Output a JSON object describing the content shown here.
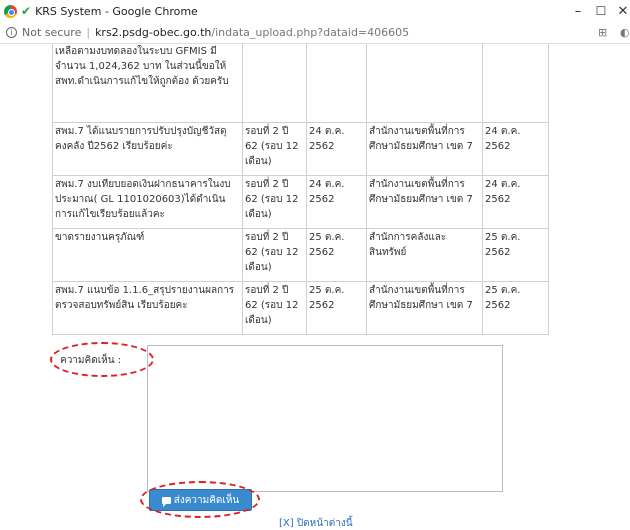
{
  "window": {
    "title": "KRS System - Google Chrome",
    "minimize": "–",
    "maximize": "☐",
    "close": "✕"
  },
  "address": {
    "security": "Not secure",
    "host": "krs2.psdg-obec.go.th",
    "path": "/indata_upload.php?dataid=406605"
  },
  "table": {
    "rows": [
      [
        "เหลือตามงบทดลองในระบบ GFMIS มีจำนวน 1,024,362 บาท ในส่วนนี้ขอให้ สพท.ดำเนินการแก้ไขให้ถูกต้อง ด้วยครับ",
        "",
        "",
        "",
        ""
      ],
      [
        "สพม.7 ได้แนบรายการปรับปรุงบัญชีวัสดุคงคลัง ปี2562 เรียบร้อยค่ะ",
        "รอบที่ 2 ปี 62 (รอบ 12 เดือน)",
        "24 ต.ค. 2562",
        "สำนักงานเขตพื้นที่การศึกษามัธยมศึกษา เขต 7",
        "24 ต.ค. 2562"
      ],
      [
        "สพม.7 งบเทียบยอดเงินฝากธนาคารในงบประมาณ( GL 1101020603)ได้ดำเนินการแก้ไขเรียบร้อยแล้วคะ",
        "รอบที่ 2 ปี 62 (รอบ 12 เดือน)",
        "24 ต.ค. 2562",
        "สำนักงานเขตพื้นที่การศึกษามัธยมศึกษา เขต 7",
        "24 ต.ค. 2562"
      ],
      [
        "ขาดรายงานครุภัณฑ์",
        "รอบที่ 2 ปี 62 (รอบ 12 เดือน)",
        "25 ต.ค. 2562",
        "สำนักการคลังและสินทรัพย์",
        "25 ต.ค. 2562"
      ],
      [
        "สพม.7 แนบข้อ 1.1.6_สรุปรายงานผลการตรวจสอบทรัพย์สิน เรียบร้อยคะ",
        "รอบที่ 2 ปี 62 (รอบ 12 เดือน)",
        "25 ต.ค. 2562",
        "สำนักงานเขตพื้นที่การศึกษามัธยมศึกษา เขต 7",
        "25 ต.ค. 2562"
      ]
    ]
  },
  "form": {
    "comment_label": "ความคิดเห็น :",
    "comment_value": "",
    "send_label": "ส่งความคิดเห็น",
    "close_label": "[X] ปิดหน้าต่างนี้"
  },
  "colors": {
    "button": "#3a8ad0",
    "annotation": "#e02020",
    "link": "#2a6cc0"
  }
}
